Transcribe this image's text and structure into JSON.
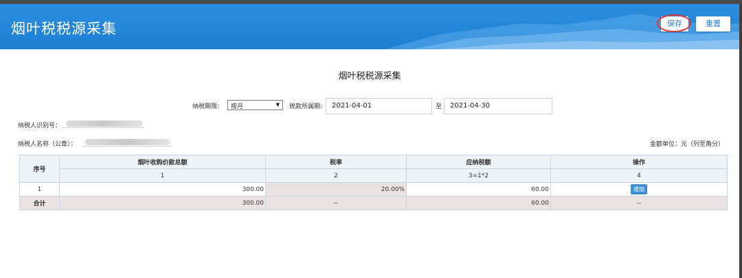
{
  "header": {
    "title": "烟叶税税源采集",
    "save_label": "保存",
    "reset_label": "重置"
  },
  "page_title": "烟叶税税源采集",
  "form": {
    "period_label": "纳税期限:",
    "period_value": "按月",
    "tax_period_label": "税款所属期:",
    "start_date": "2021-04-01",
    "to_label": "至",
    "end_date": "2021-04-30",
    "taxpayer_id_label": "纳税人识别号：",
    "taxpayer_name_label": "纳税人名称（公章）：",
    "unit_label": "金额单位：元（列至角分）"
  },
  "table": {
    "headers": [
      "序号",
      "烟叶收购价款总额",
      "税率",
      "应纳税额",
      "操作"
    ],
    "col_numbers": [
      "1",
      "2",
      "3=1*2",
      "4"
    ],
    "row": {
      "index": "1",
      "amount": "300.00",
      "rate": "20.00%",
      "tax": "60.00",
      "action": "增加"
    },
    "total": {
      "label": "合计",
      "amount": "300.00",
      "rate": "--",
      "tax": "60.00",
      "action": "--"
    }
  },
  "colors": {
    "header_blue": "#1d7fd4",
    "highlight_circle": "#e0352f",
    "add_button": "#3d8fd8"
  }
}
